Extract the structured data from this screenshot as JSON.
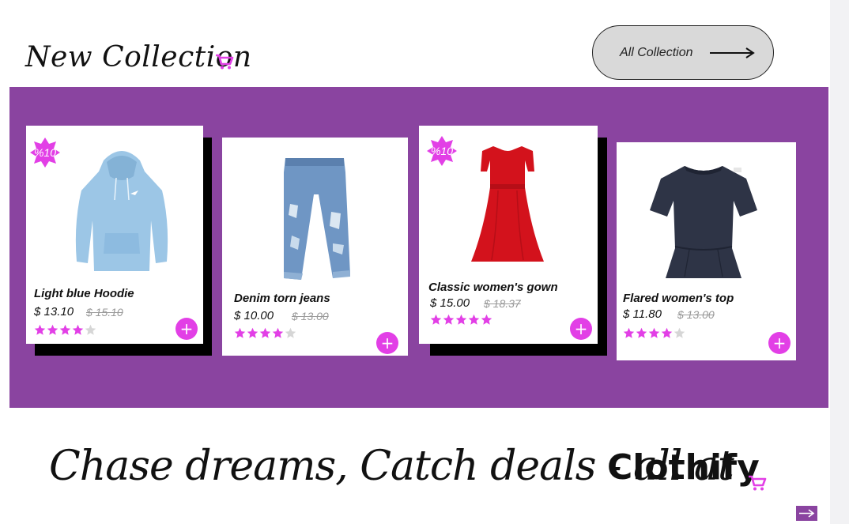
{
  "header": {
    "title": "New Collection",
    "cart_icon": "cart-icon",
    "all_collection_label": "All Collection"
  },
  "colors": {
    "band": "#8a44a0",
    "accent": "#e23fe6",
    "star_filled": "#e23fe6",
    "star_empty": "#d6d6d6"
  },
  "products": [
    {
      "name": "Light blue Hoodie",
      "price": "$ 13.10",
      "old_price": "$ 15.10",
      "rating": 4,
      "badge": "%10",
      "image": "hoodie"
    },
    {
      "name": "Denim torn jeans",
      "price": "$ 10.00",
      "old_price": "$ 13.00",
      "rating": 4,
      "badge": "",
      "image": "jeans"
    },
    {
      "name": "Classic women's gown",
      "price": "$ 15.00",
      "old_price": "$ 18.37",
      "rating": 5,
      "badge": "%10",
      "image": "gown"
    },
    {
      "name": "Flared women's top",
      "price": "$ 11.80",
      "old_price": "$ 13.00",
      "rating": 4,
      "badge": "",
      "image": "top"
    }
  ],
  "tagline": {
    "text": "Chase dreams, Catch deals - all at",
    "brand": "Clothify"
  }
}
